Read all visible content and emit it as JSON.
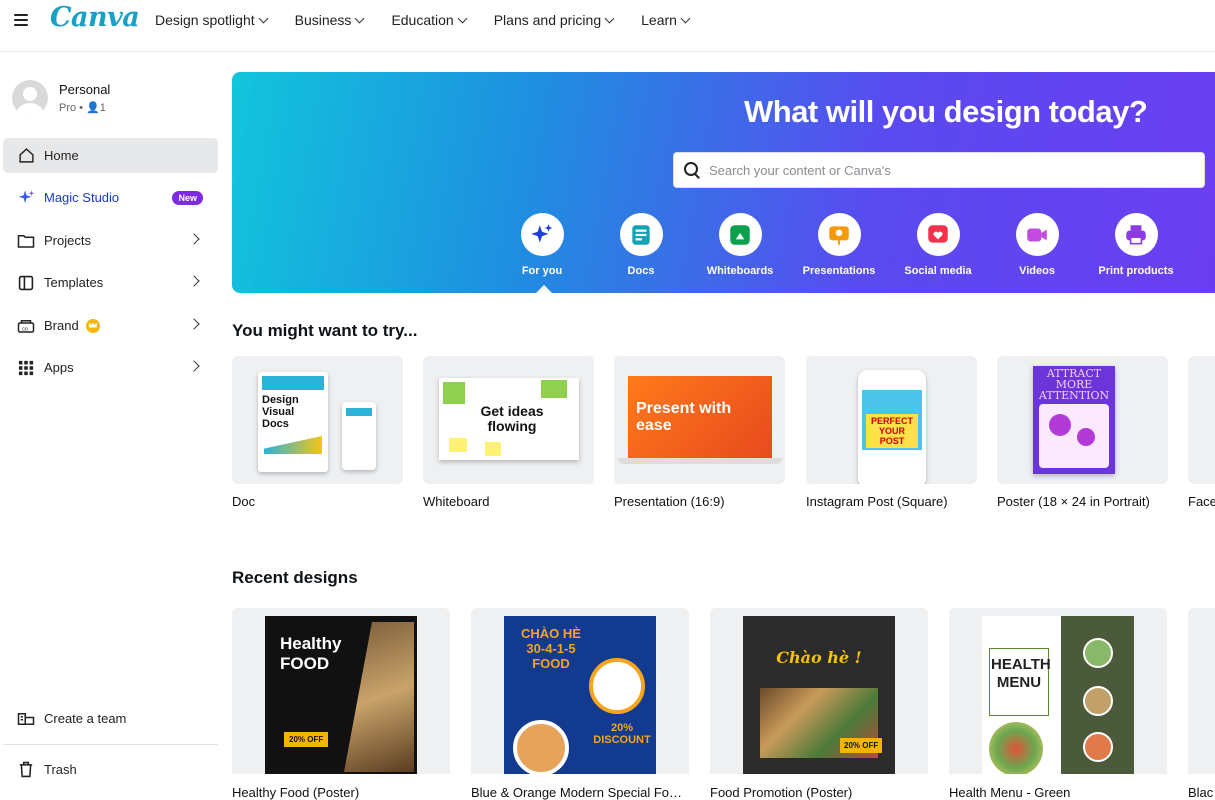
{
  "header": {
    "logo": "Canva",
    "nav": [
      {
        "label": "Design spotlight"
      },
      {
        "label": "Business"
      },
      {
        "label": "Education"
      },
      {
        "label": "Plans and pricing"
      },
      {
        "label": "Learn"
      }
    ]
  },
  "sidebar": {
    "profile": {
      "name": "Personal",
      "plan": "Pro • 👤1"
    },
    "items": [
      {
        "label": "Home",
        "icon": "home-icon"
      },
      {
        "label": "Magic Studio",
        "icon": "sparkle-icon",
        "badge": "New"
      },
      {
        "label": "Projects",
        "icon": "folder-icon"
      },
      {
        "label": "Templates",
        "icon": "templates-icon"
      },
      {
        "label": "Brand",
        "icon": "brand-icon"
      },
      {
        "label": "Apps",
        "icon": "apps-icon"
      }
    ],
    "bottom": [
      {
        "label": "Create a team",
        "icon": "team-icon"
      },
      {
        "label": "Trash",
        "icon": "trash-icon"
      }
    ]
  },
  "hero": {
    "title": "What will you design today?",
    "search_placeholder": "Search your content or Canva's",
    "categories": [
      {
        "label": "For you",
        "icon": "sparkle-icon",
        "color": "#1e3fd8"
      },
      {
        "label": "Docs",
        "icon": "doc-icon",
        "color": "#13a3b5"
      },
      {
        "label": "Whiteboards",
        "icon": "whiteboard-icon",
        "color": "#0e9f4f"
      },
      {
        "label": "Presentations",
        "icon": "presentation-icon",
        "color": "#f59b0b"
      },
      {
        "label": "Social media",
        "icon": "heart-icon",
        "color": "#f0324b"
      },
      {
        "label": "Videos",
        "icon": "video-icon",
        "color": "#c44be0"
      },
      {
        "label": "Print products",
        "icon": "printer-icon",
        "color": "#8b3be0"
      }
    ]
  },
  "try_section": {
    "title": "You might want to try...",
    "cards": [
      {
        "label": "Doc",
        "thumb_text": "Design Visual Docs"
      },
      {
        "label": "Whiteboard",
        "thumb_text": "Get ideas flowing"
      },
      {
        "label": "Presentation (16:9)",
        "thumb_text": "Present with ease"
      },
      {
        "label": "Instagram Post (Square)",
        "thumb_text": "PERFECT YOUR POST"
      },
      {
        "label": "Poster (18 × 24 in Portrait)",
        "thumb_text": "ATTRACT MORE ATTENTION"
      },
      {
        "label": "Face",
        "thumb_text": ""
      }
    ]
  },
  "recent_section": {
    "title": "Recent designs",
    "cards": [
      {
        "label": "Healthy Food (Poster)",
        "thumb_text": "Healthy FOOD",
        "badge": "20% OFF"
      },
      {
        "label": "Blue & Orange Modern Special Food Poster",
        "thumb_text": "CHÀO HÈ 30-4-1-5 FOOD",
        "badge": "20% DISCOUNT"
      },
      {
        "label": "Food Promotion (Poster)",
        "thumb_text": "Chào hè !",
        "badge": "20% OFF"
      },
      {
        "label": "Health Menu - Green",
        "thumb_text": "HEALTH MENU"
      },
      {
        "label": "Blac",
        "thumb_text": ""
      }
    ]
  }
}
